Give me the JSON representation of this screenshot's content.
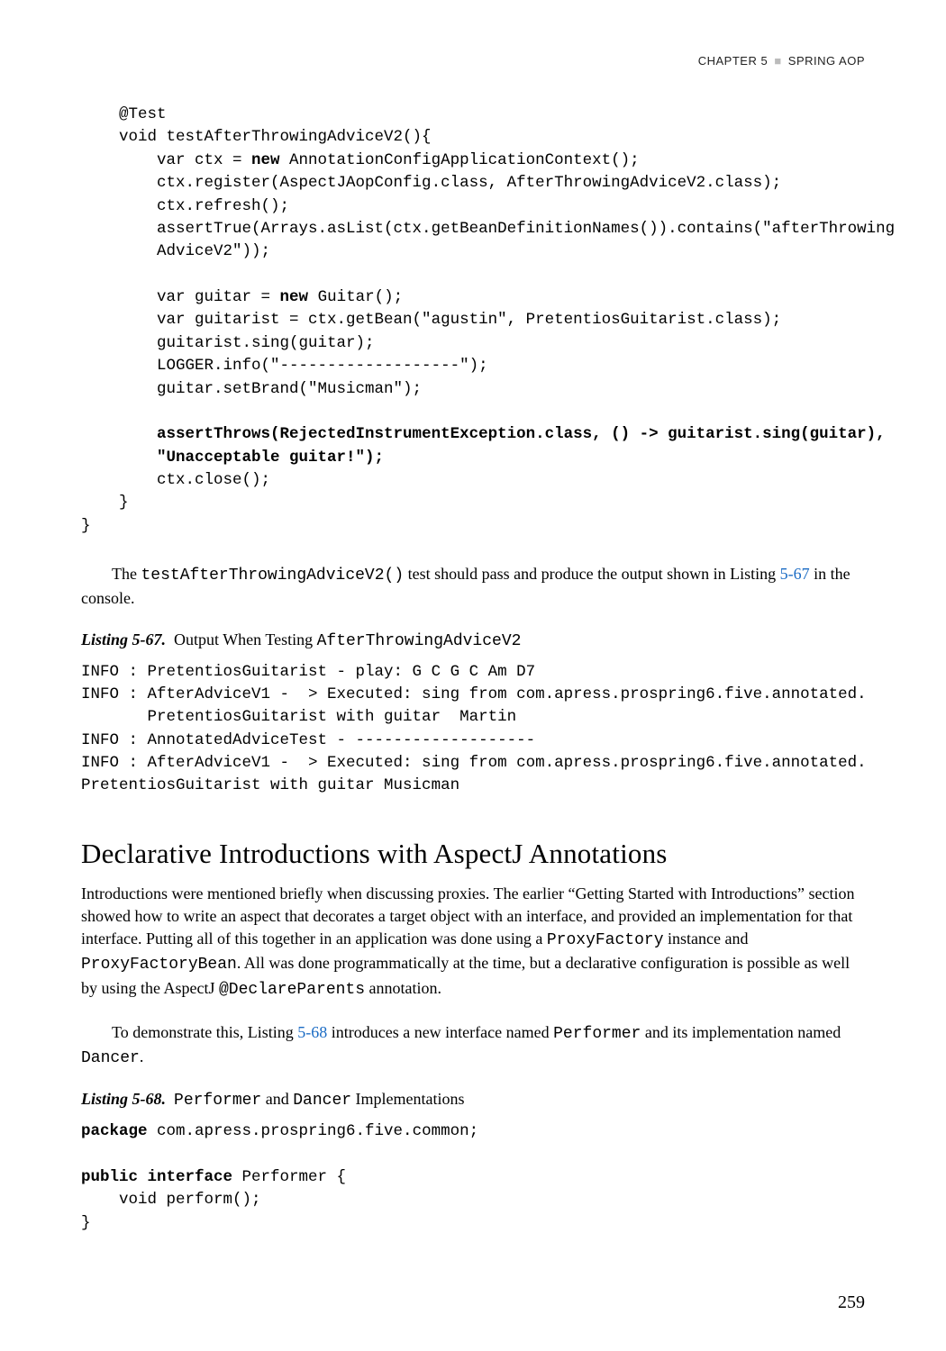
{
  "running_head": {
    "left": "CHAPTER 5",
    "right": "SPRING AOP"
  },
  "code_block_1": "    @Test\n    void testAfterThrowingAdviceV2(){\n        var ctx = <b>new</b> AnnotationConfigApplicationContext();\n        ctx.register(AspectJAopConfig.class, AfterThrowingAdviceV2.class);\n        ctx.refresh();\n        assertTrue(Arrays.asList(ctx.getBeanDefinitionNames()).contains(\"afterThrowing\n        AdviceV2\"));\n\n        var guitar = <b>new</b> Guitar();\n        var guitarist = ctx.getBean(\"agustin\", PretentiosGuitarist.class);\n        guitarist.sing(guitar);\n        LOGGER.info(\"-------------------\");\n        guitar.setBrand(\"Musicman\");\n\n        <b>assertThrows(RejectedInstrumentException.class, () -> guitarist.sing(guitar),</b>\n        <b>\"Unacceptable guitar!\");</b>\n        ctx.close();\n    }\n}",
  "para_1_pre": "The ",
  "para_1_code": "testAfterThrowingAdviceV2()",
  "para_1_mid": " test should pass and produce the output shown in Listing ",
  "para_1_link": "5-67",
  "para_1_post": " in the console.",
  "listing_67_label": "Listing 5-67.",
  "listing_67_caption_pre": "Output When Testing ",
  "listing_67_caption_code": "AfterThrowingAdviceV2",
  "code_block_2": "INFO : PretentiosGuitarist - play: G C G C Am D7\nINFO : AfterAdviceV1 -  > Executed: sing from com.apress.prospring6.five.annotated.\n       PretentiosGuitarist with guitar  Martin\nINFO : AnnotatedAdviceTest - -------------------\nINFO : AfterAdviceV1 -  > Executed: sing from com.apress.prospring6.five.annotated.\nPretentiosGuitarist with guitar Musicman",
  "section_heading": "Declarative Introductions with AspectJ Annotations",
  "para_2_a": "Introductions were mentioned briefly when discussing proxies. The earlier “Getting Started with Introductions” section showed how to write an aspect that decorates a target object with an interface, and provided an implementation for that interface. Putting all of this together in an application was done using a ",
  "para_2_code1": "ProxyFactory",
  "para_2_b": " instance and ",
  "para_2_code2": "ProxyFactoryBean",
  "para_2_c": ". All was done programmatically at the time, but a declarative configuration is possible as well by using the AspectJ ",
  "para_2_code3": "@DeclareParents",
  "para_2_d": " annotation.",
  "para_3_a": "To demonstrate this, Listing ",
  "para_3_link": "5-68",
  "para_3_b": " introduces a new interface named ",
  "para_3_code1": "Performer",
  "para_3_c": " and its implementation named ",
  "para_3_code2": "Dancer",
  "para_3_d": ".",
  "listing_68_label": "Listing 5-68.",
  "listing_68_caption_code1": "Performer",
  "listing_68_caption_mid": " and ",
  "listing_68_caption_code2": "Dancer",
  "listing_68_caption_post": " Implementations",
  "code_block_3": "<b>package</b> com.apress.prospring6.five.common;\n\n<b>public interface</b> Performer {\n    void perform();\n}",
  "page_number": "259"
}
